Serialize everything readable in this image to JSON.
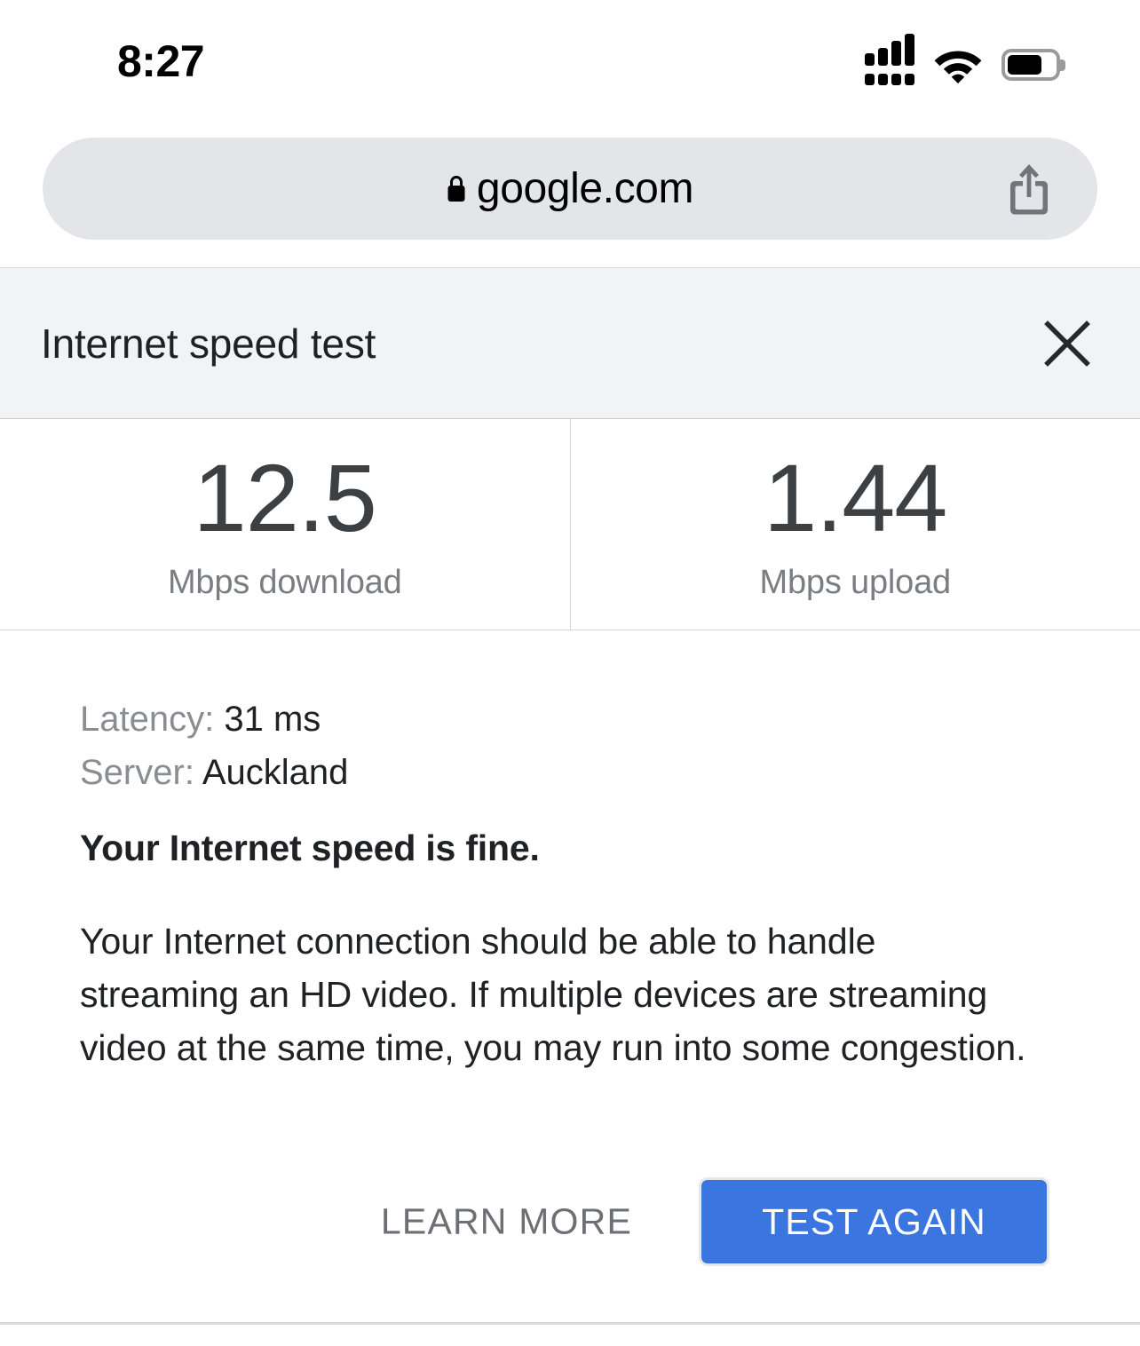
{
  "statusbar": {
    "time": "8:27",
    "icons": {
      "cellular": "cellular-signal-icon",
      "wifi": "wifi-icon",
      "battery": "battery-icon"
    },
    "battery_fill_percent": 62
  },
  "browser": {
    "url": "google.com",
    "lock_icon": "lock-icon",
    "share_icon": "share-icon"
  },
  "card": {
    "title": "Internet speed test",
    "close_icon": "close-icon"
  },
  "results": {
    "download": {
      "value": "12.5",
      "label": "Mbps download"
    },
    "upload": {
      "value": "1.44",
      "label": "Mbps upload"
    }
  },
  "details": {
    "latency_label": "Latency:",
    "latency_value": "31 ms",
    "server_label": "Server:",
    "server_value": "Auckland"
  },
  "verdict": "Your Internet speed is fine.",
  "description": "Your Internet connection should be able to handle streaming an HD video. If multiple devices are streaming video at the same time, you may run into some congestion.",
  "actions": {
    "learn_more": "LEARN MORE",
    "test_again": "TEST AGAIN"
  },
  "colors": {
    "accent_blue": "#3b76e0",
    "header_bg": "#f1f3f4",
    "urlbar_bg": "#e4e5e9",
    "text_primary": "#202124",
    "text_secondary": "#8a8d91",
    "divider": "#d3d6da"
  }
}
